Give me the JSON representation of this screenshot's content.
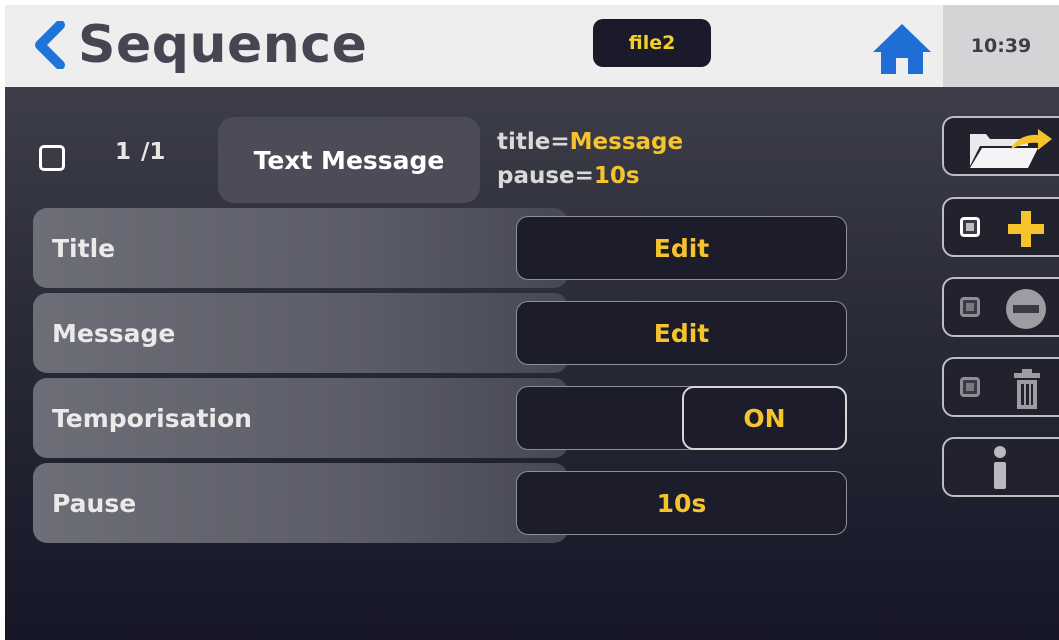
{
  "header": {
    "title": "Sequence",
    "file_badge": "file2",
    "time": "10:39"
  },
  "step": {
    "counter": "1 /1",
    "type_label": "Text Message",
    "summary": {
      "title_key": "title=",
      "title_value": "Message",
      "pause_key": "pause=",
      "pause_value": "10s"
    }
  },
  "params": [
    {
      "label": "Title",
      "value": "Edit"
    },
    {
      "label": "Message",
      "value": "Edit"
    },
    {
      "label": "Temporisation",
      "value": "ON"
    },
    {
      "label": "Pause",
      "value": "10s"
    }
  ],
  "toolbar": {
    "icons": [
      "folder-open-icon",
      "add-step-icon",
      "remove-step-icon",
      "trash-icon",
      "info-icon"
    ]
  },
  "colors": {
    "accent": "#f5c32c",
    "header_bg": "#eeeeee",
    "back_arrow": "#1f74d8",
    "home_icon": "#1e6ed6",
    "panel_bg": "#1b1b2a"
  }
}
